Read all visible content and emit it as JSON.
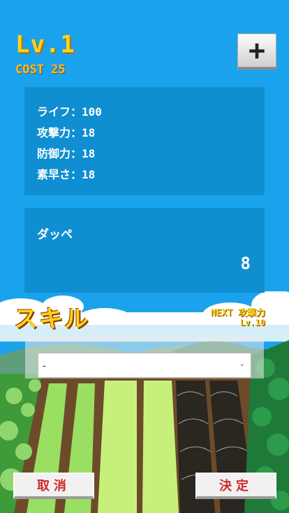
{
  "header": {
    "level": "Lv.1",
    "cost": "COST 25",
    "plus_icon": "plus-icon"
  },
  "stats": [
    {
      "label": "ライフ：100"
    },
    {
      "label": "攻撃力：18"
    },
    {
      "label": "防御力：18"
    },
    {
      "label": "素早さ：18"
    }
  ],
  "character": {
    "name": "ダッペ",
    "number": "8"
  },
  "skill": {
    "title": "スキル",
    "next_label": "NEXT 攻撃力",
    "next_level": "Lv.10",
    "selected": "-"
  },
  "buttons": {
    "cancel": "取消",
    "confirm": "決定"
  },
  "colors": {
    "sky": "#1aa3ec",
    "panel": "#0f8fd1",
    "gold": "#ffd21a",
    "button_text": "#d0282c"
  }
}
